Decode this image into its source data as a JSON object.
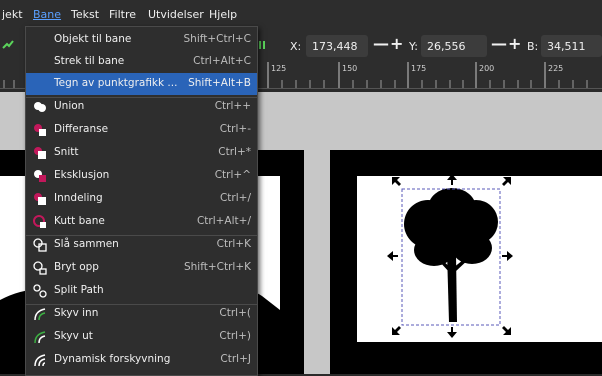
{
  "menubar": {
    "items": [
      {
        "label": "jekt"
      },
      {
        "label": "Bane"
      },
      {
        "label": "Tekst"
      },
      {
        "label": "Filtre"
      },
      {
        "label": "Utvidelser"
      },
      {
        "label": "Hjelp"
      }
    ]
  },
  "toolbar": {
    "x_label": "X:",
    "x_value": "173,448",
    "y_label": "Y:",
    "y_value": "26,556",
    "b_label": "B:",
    "b_value": "34,511",
    "minus": "—",
    "plus": "+"
  },
  "ruler": {
    "ticks": [
      "125",
      "150",
      "175",
      "200",
      "225"
    ]
  },
  "menu": {
    "items": [
      {
        "label": "Objekt til bane",
        "shortcut": "Shift+Ctrl+C",
        "icon": "none"
      },
      {
        "label": "Strek til bane",
        "shortcut": "Ctrl+Alt+C",
        "icon": "none"
      },
      {
        "label": "Tegn av punktgrafikk ...",
        "shortcut": "Shift+Alt+B",
        "icon": "none",
        "highlighted": true
      },
      {
        "label": "Union",
        "shortcut": "Ctrl++",
        "icon": "union-icon"
      },
      {
        "label": "Differanse",
        "shortcut": "Ctrl+-",
        "icon": "difference-icon"
      },
      {
        "label": "Snitt",
        "shortcut": "Ctrl+*",
        "icon": "intersection-icon"
      },
      {
        "label": "Eksklusjon",
        "shortcut": "Ctrl+^",
        "icon": "exclusion-icon"
      },
      {
        "label": "Inndeling",
        "shortcut": "Ctrl+/",
        "icon": "division-icon"
      },
      {
        "label": "Kutt bane",
        "shortcut": "Ctrl+Alt+/",
        "icon": "cut-path-icon"
      },
      {
        "label": "Slå sammen",
        "shortcut": "Ctrl+K",
        "icon": "combine-icon"
      },
      {
        "label": "Bryt opp",
        "shortcut": "Shift+Ctrl+K",
        "icon": "break-apart-icon"
      },
      {
        "label": "Split Path",
        "shortcut": "",
        "icon": "split-path-icon"
      },
      {
        "label": "Skyv inn",
        "shortcut": "Ctrl+(",
        "icon": "inset-icon"
      },
      {
        "label": "Skyv ut",
        "shortcut": "Ctrl+)",
        "icon": "outset-icon"
      },
      {
        "label": "Dynamisk forskyvning",
        "shortcut": "Ctrl+J",
        "icon": "dynamic-offset-icon"
      }
    ]
  },
  "colors": {
    "highlight": "#2a64b8",
    "active_menu": "#5aa0ff",
    "boolean_icon": "#c2185b"
  }
}
